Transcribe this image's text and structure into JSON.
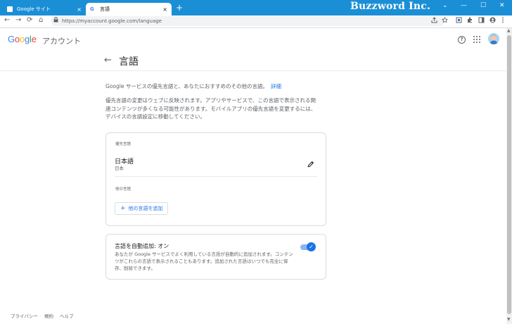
{
  "window": {
    "brand": "Buzzword Inc.",
    "tabs": [
      {
        "title": "Google サイト",
        "close": "×",
        "favicon_color": "#1a73e8"
      },
      {
        "title": "言語",
        "close": "×",
        "favicon_letter": "G"
      }
    ],
    "new_tab": "+",
    "controls": {
      "chevron": "⌄",
      "minimize": "—",
      "maximize": "☐",
      "close": "✕"
    }
  },
  "addressbar": {
    "url": "https://myaccount.google.com/language",
    "nav": {
      "back": "←",
      "forward": "→",
      "reload": "⟳",
      "home": "⌂"
    },
    "lock": "🔒",
    "icons": [
      "share-icon",
      "star-icon",
      "extension-icon",
      "puzzle-icon",
      "sidepanel-icon",
      "profile-icon",
      "menu-icon"
    ]
  },
  "header": {
    "logo_letters": [
      {
        "ch": "G",
        "color": "#4285f4"
      },
      {
        "ch": "o",
        "color": "#ea4335"
      },
      {
        "ch": "o",
        "color": "#fbbc05"
      },
      {
        "ch": "g",
        "color": "#4285f4"
      },
      {
        "ch": "l",
        "color": "#34a853"
      },
      {
        "ch": "e",
        "color": "#ea4335"
      }
    ],
    "account_label": "アカウント",
    "help": "?"
  },
  "page": {
    "back_arrow": "←",
    "title": "言語",
    "intro": "Google サービスの優先言語と、あなたにおすすめのその他の言語。",
    "intro_link": "詳細",
    "description": "優先言語の変更はウェブに反映されます。アプリやサービスで、この言語で表示される関連コンテンツが多くなる可能性があります。モバイルアプリの優先言語を変更するには、デバイスの言語設定に移動してください。"
  },
  "preferred": {
    "label": "優先言語",
    "name": "日本語",
    "sub": "日本"
  },
  "other": {
    "label": "他の言語",
    "add_button": "他の言語を追加",
    "add_icon": "+"
  },
  "auto_add": {
    "title": "言語を自動追加: オン",
    "description": "あなたが Google サービスでよく利用している言語が自動的に追加されます。コンテンツがこれらの言語で表示されることもあります。追加された言語はいつでも完全に保存、削除できます。",
    "enabled": true,
    "check": "✓"
  },
  "footer": {
    "links": [
      "プライバシー",
      "規約",
      "ヘルプ"
    ]
  },
  "colors": {
    "titlebar": "#1b8fd6",
    "accent": "#1a73e8"
  }
}
